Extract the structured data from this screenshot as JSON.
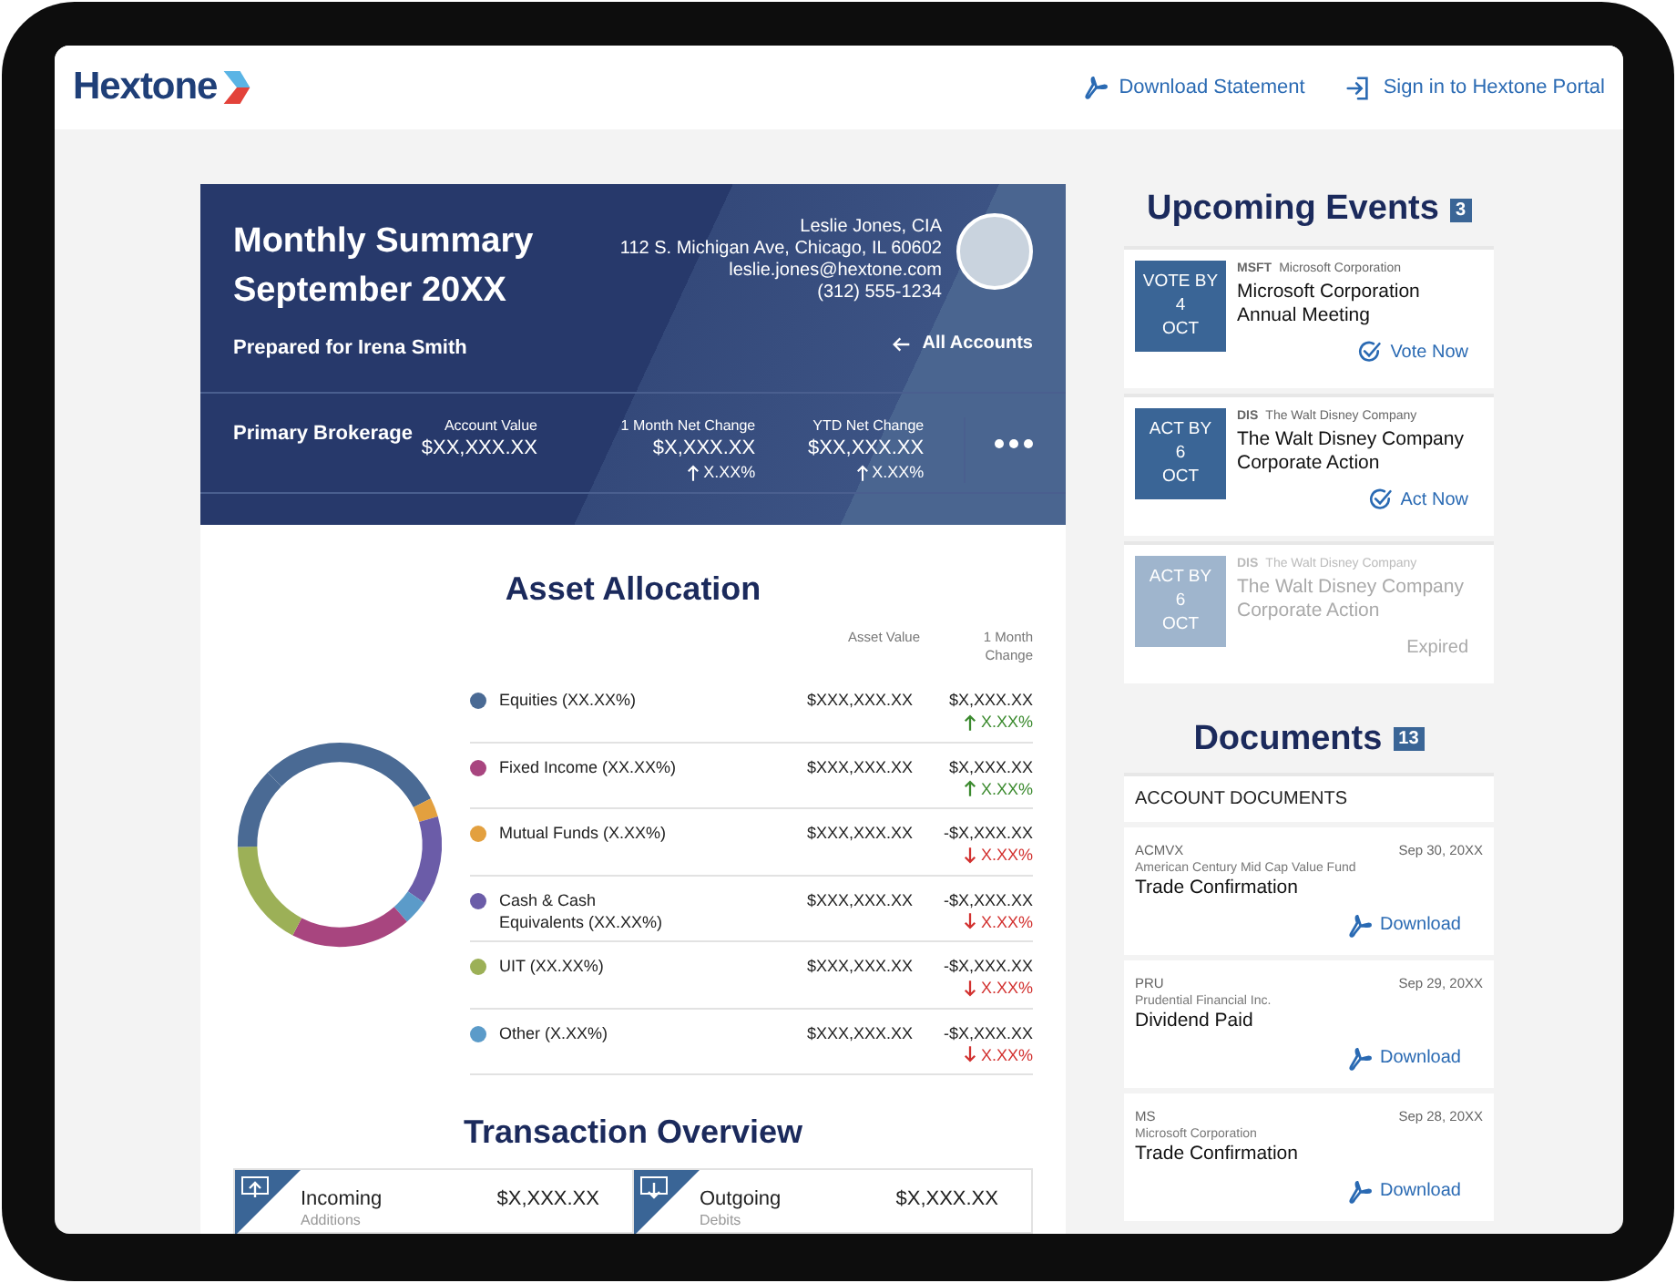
{
  "header": {
    "logo": "Hextone",
    "links": [
      {
        "label": "Download Statement",
        "kind": "pdf"
      },
      {
        "label": "Sign in to Hextone Portal",
        "kind": "signin"
      }
    ]
  },
  "summary": {
    "title_lines": [
      "Monthly Summary",
      "September 20XX"
    ],
    "prepared_for": "Prepared for Irena Smith",
    "advisor": [
      "Leslie Jones, CIA",
      "112 S. Michigan Ave, Chicago, IL 60602",
      "leslie.jones@hextone.com",
      "(312) 555-1234"
    ],
    "back_link": "All Accounts",
    "account": {
      "name": "Primary Brokerage",
      "metrics": [
        {
          "label": "Account Value",
          "value": "$XX,XXX.XX"
        },
        {
          "label": "1 Month Net Change",
          "value": "$X,XXX.XX",
          "change": "X.XX%"
        },
        {
          "label": "YTD Net Change",
          "value": "$XX,XXX.XX",
          "change": "X.XX%"
        }
      ]
    }
  },
  "allocation": {
    "title": "Asset Allocation",
    "columns": [
      "Asset Value",
      "1 Month Change"
    ],
    "rows": [
      {
        "label": "Equities (XX.XX%)",
        "color": "#4a6a94",
        "value": "$XXX,XXX.XX",
        "change": "$X,XXX.XX",
        "change_pct": "X.XX%",
        "rising": true
      },
      {
        "label": "Fixed Income (XX.XX%)",
        "color": "#a8457f",
        "value": "$XXX,XXX.XX",
        "change": "$X,XXX.XX",
        "change_pct": "X.XX%",
        "rising": true
      },
      {
        "label": "Mutual Funds (X.XX%)",
        "color": "#e3a03f",
        "value": "$XXX,XXX.XX",
        "change": "-$X,XXX.XX",
        "change_pct": "X.XX%",
        "rising": false
      },
      {
        "label": "Cash & Cash Equivalents (XX.XX%)",
        "color": "#6b5ca8",
        "value": "$XXX,XXX.XX",
        "change": "-$X,XXX.XX",
        "change_pct": "X.XX%",
        "rising": false
      },
      {
        "label": "UIT (XX.XX%)",
        "color": "#9cb057",
        "value": "$XXX,XXX.XX",
        "change": "-$X,XXX.XX",
        "change_pct": "X.XX%",
        "rising": false
      },
      {
        "label": "Other (X.XX%)",
        "color": "#5b9bc9",
        "value": "$XXX,XXX.XX",
        "change": "-$X,XXX.XX",
        "change_pct": "X.XX%",
        "rising": false
      }
    ]
  },
  "transactions": {
    "title": "Transaction Overview",
    "items": [
      {
        "kind": "incoming",
        "label": "Incoming",
        "sublabel": "Additions",
        "amount": "$X,XXX.XX"
      },
      {
        "kind": "outgoing",
        "label": "Outgoing",
        "sublabel": "Debits",
        "amount": "$X,XXX.XX"
      }
    ]
  },
  "events": {
    "title": "Upcoming Events",
    "count": "3",
    "items": [
      {
        "badge": [
          "VOTE BY",
          "4",
          "OCT"
        ],
        "ticker": "MSFT",
        "company": "Microsoft Corporation",
        "title": "Microsoft Corporation Annual Meeting",
        "action": "Vote Now",
        "expired": false
      },
      {
        "badge": [
          "ACT BY",
          "6",
          "OCT"
        ],
        "ticker": "DIS",
        "company": "The Walt Disney Company",
        "title": "The Walt Disney Company Corporate Action",
        "action": "Act Now",
        "expired": false
      },
      {
        "badge": [
          "ACT BY",
          "6",
          "OCT"
        ],
        "ticker": "DIS",
        "company": "The Walt Disney Company",
        "title": "The Walt Disney Company Corporate Action",
        "action": "Expired",
        "expired": true
      }
    ]
  },
  "documents": {
    "title": "Documents",
    "count": "13",
    "section": "ACCOUNT DOCUMENTS",
    "items": [
      {
        "ticker": "ACMVX",
        "date": "Sep 30, 20XX",
        "company": "American Century Mid Cap Value Fund",
        "title": "Trade Confirmation",
        "action": "Download"
      },
      {
        "ticker": "PRU",
        "date": "Sep 29, 20XX",
        "company": "Prudential Financial Inc.",
        "title": "Dividend Paid",
        "action": "Download"
      },
      {
        "ticker": "MS",
        "date": "Sep 28, 20XX",
        "company": "Microsoft Corporation",
        "title": "Trade Confirmation",
        "action": "Download"
      }
    ]
  }
}
